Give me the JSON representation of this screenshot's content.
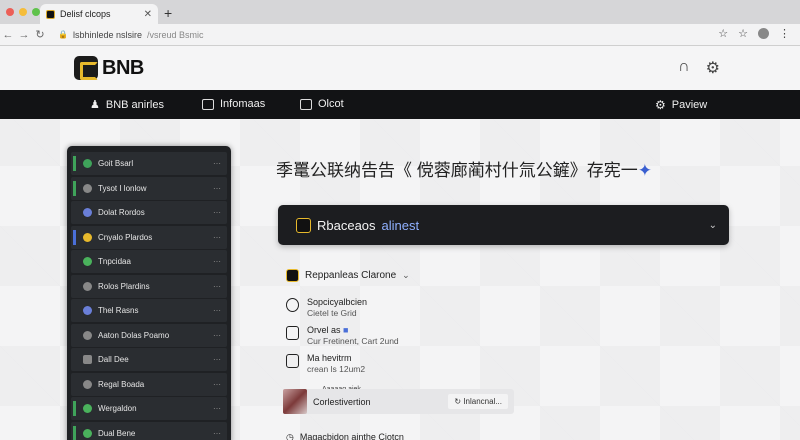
{
  "browser": {
    "tab_title": "Delisf clcops",
    "url_main": "lsbhinlede nslsire",
    "url_path": "/vsreud Bsmic"
  },
  "site": {
    "brand": "BNB"
  },
  "nav": {
    "items": [
      {
        "label": "BNB anirles"
      },
      {
        "label": "Infomaas"
      },
      {
        "label": "Olcot"
      },
      {
        "label": "Paview"
      }
    ]
  },
  "sidebar": {
    "items": [
      {
        "label": "Goit Bsarl",
        "color": "#3fa35a"
      },
      {
        "label": "Tysot I lonlow",
        "color": "#888888"
      },
      {
        "label": "Dolat Rordos",
        "color": "#6a7fd8"
      },
      {
        "label": "Cnyalo Plardos",
        "color": "#e7b92c"
      },
      {
        "label": "Tnpcidaa",
        "color": "#4ab25c"
      },
      {
        "label": "Rolos Plardins",
        "color": "#888888"
      },
      {
        "label": "Thel Rasns",
        "color": "#6a7fd8"
      },
      {
        "label": "Aaton Dolas Poamo",
        "color": "#888888"
      },
      {
        "label": "Dall Dee",
        "color": "#888888"
      },
      {
        "label": "Regal Boada",
        "color": "#888888"
      },
      {
        "label": "Wergaldon",
        "color": "#4ab25c"
      },
      {
        "label": "Dual Bene",
        "color": "#4ab25c"
      }
    ]
  },
  "main": {
    "headline": "季鼍公联纳告告《 傥蓉廊蔺村什氚公鏟》存宪一",
    "card_title": "Rbaceaos",
    "card_title_accent": "alinest",
    "dropdown_label": "Reppanleas Clarone",
    "list": [
      {
        "title": "Sopcicyalbcien",
        "sub": "Cietel te Grid"
      },
      {
        "title": "Orvel as",
        "sub": "Cur Fretinent, Cart 2und"
      },
      {
        "title": "Ma hevitrm",
        "sub": "crean ls 12um2"
      }
    ],
    "row_caption": "Aaaaag aiek",
    "row_text": "Corlestivertion",
    "row_action": "Inlancnal...",
    "bottom_item": "Magacbidon ainthe Ciotcn"
  }
}
